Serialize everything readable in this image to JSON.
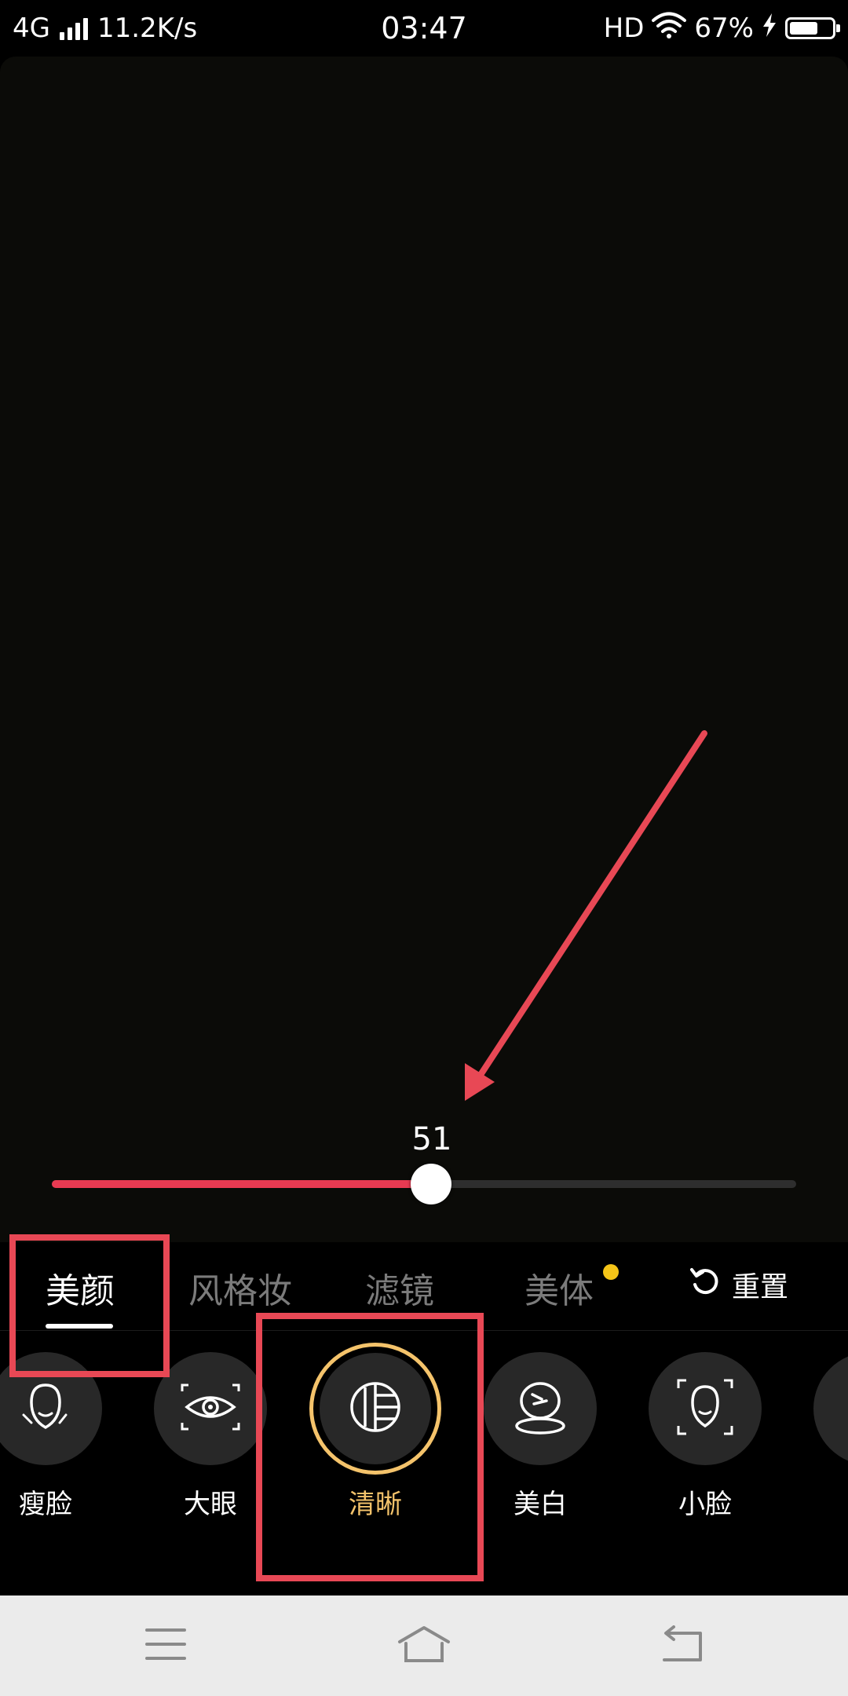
{
  "status_bar": {
    "network": "4G",
    "speed": "11.2K/s",
    "time": "03:47",
    "hd": "HD",
    "battery": "67%",
    "battery_level": 0.67,
    "icons": [
      "signal-icon",
      "wifi-icon",
      "charging-icon",
      "battery-icon"
    ]
  },
  "slider": {
    "value_label": "51",
    "value": 51,
    "max": 100,
    "fill_color": "#e83a52"
  },
  "tabs": [
    {
      "label": "美颜",
      "active": true
    },
    {
      "label": "风格妆",
      "active": false
    },
    {
      "label": "滤镜",
      "active": false
    },
    {
      "label": "美体",
      "active": false,
      "badge_dot": true
    }
  ],
  "reset": {
    "label": "重置",
    "icon": "reset-icon"
  },
  "tools": [
    {
      "label": "瘦脸",
      "icon": "slim-face-icon"
    },
    {
      "label": "大眼",
      "icon": "big-eye-icon"
    },
    {
      "label": "清晰",
      "icon": "clarity-icon",
      "selected": true
    },
    {
      "label": "美白",
      "icon": "whiten-icon"
    },
    {
      "label": "小脸",
      "icon": "small-face-icon"
    }
  ],
  "navbar": {
    "icons": [
      "menu-icon",
      "home-icon",
      "back-icon"
    ]
  },
  "colors": {
    "accent_selected": "#f4c36b",
    "highlight": "#e84855",
    "badge_dot": "#f5c518"
  }
}
